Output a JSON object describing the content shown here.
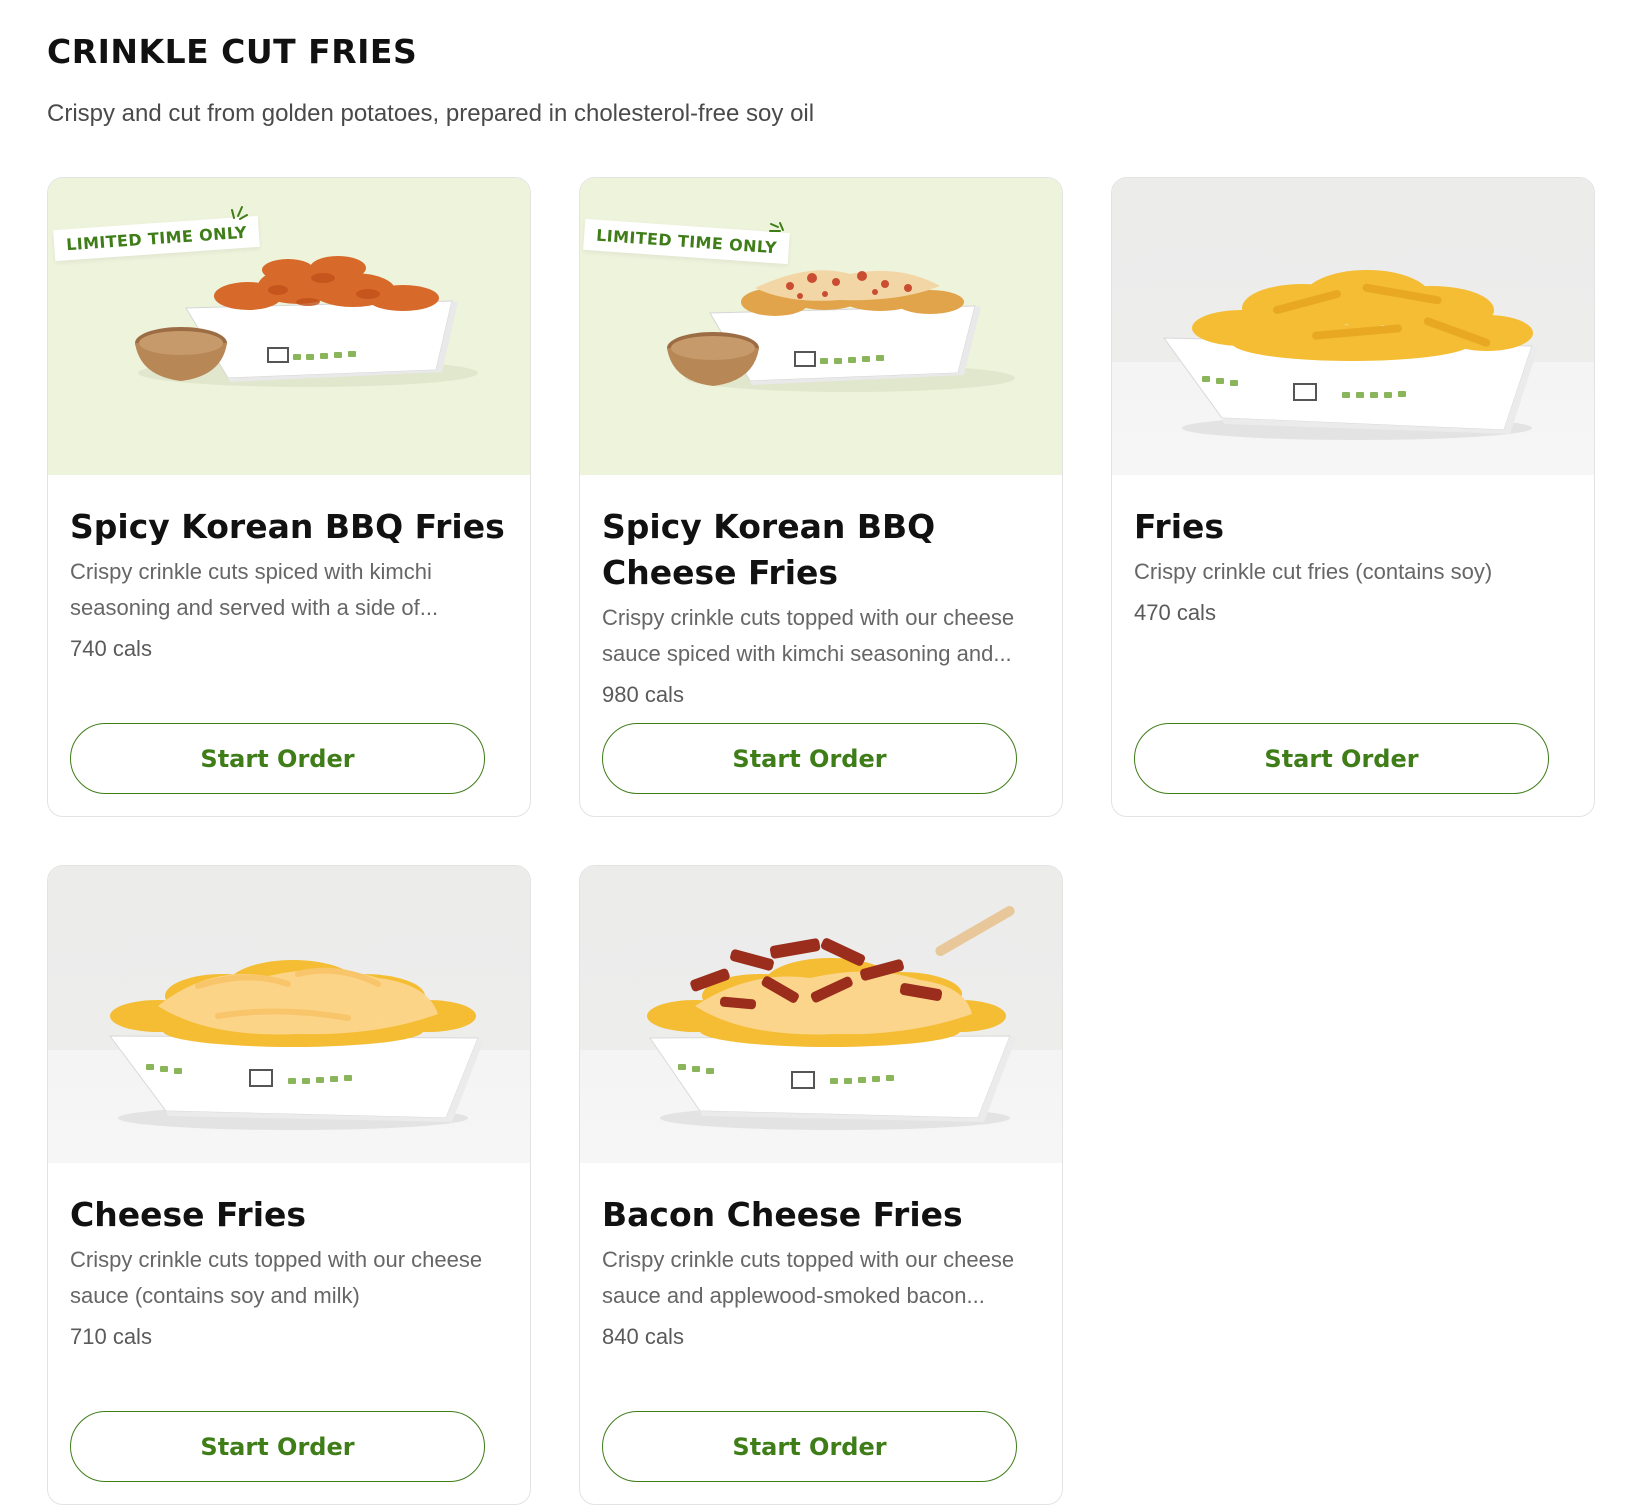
{
  "section": {
    "title": "CRINKLE CUT FRIES",
    "subtitle": "Crispy and cut from golden potatoes, prepared in cholesterol-free soy oil"
  },
  "colors": {
    "accent": "#3f7d19",
    "lto_background": "#eef3dc",
    "photo_background": "#ececeb",
    "card_border": "#e3e3e3"
  },
  "items": [
    {
      "title": "Spicy Korean BBQ Fries",
      "description": "Crispy crinkle cuts spiced with kimchi seasoning and served with a side of...",
      "cals": "740 cals",
      "badge": "LIMITED TIME ONLY",
      "button": "Start Order",
      "image": "spicy-korean-bbq-fries-photo"
    },
    {
      "title": "Spicy Korean BBQ Cheese Fries",
      "description": "Crispy crinkle cuts topped with our cheese sauce spiced with kimchi seasoning and...",
      "cals": "980 cals",
      "badge": "LIMITED TIME ONLY",
      "button": "Start Order",
      "image": "spicy-korean-bbq-cheese-fries-photo"
    },
    {
      "title": "Fries",
      "description": "Crispy crinkle cut fries (contains soy)",
      "cals": "470 cals",
      "badge": "",
      "button": "Start Order",
      "image": "fries-photo"
    },
    {
      "title": "Cheese Fries",
      "description": "Crispy crinkle cuts topped with our cheese sauce (contains soy and milk)",
      "cals": "710 cals",
      "badge": "",
      "button": "Start Order",
      "image": "cheese-fries-photo"
    },
    {
      "title": "Bacon Cheese Fries",
      "description": "Crispy crinkle cuts topped with our cheese sauce and applewood-smoked bacon...",
      "cals": "840 cals",
      "badge": "",
      "button": "Start Order",
      "image": "bacon-cheese-fries-photo"
    }
  ]
}
